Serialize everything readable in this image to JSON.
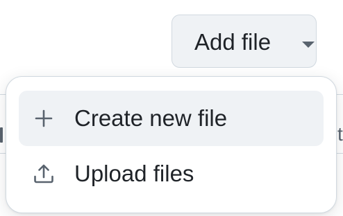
{
  "add_file_button": {
    "label": "Add file",
    "icon": "caret-down-icon"
  },
  "menu": {
    "items": [
      {
        "label": "Create new file",
        "icon": "plus-icon",
        "highlighted": true
      },
      {
        "label": "Upload files",
        "icon": "upload-icon",
        "highlighted": false
      }
    ]
  },
  "colors": {
    "button_bg": "#eff2f5",
    "border": "#d1d9e0",
    "text": "#1f2328",
    "icon": "#59636e",
    "hover_bg": "#eff2f5"
  }
}
